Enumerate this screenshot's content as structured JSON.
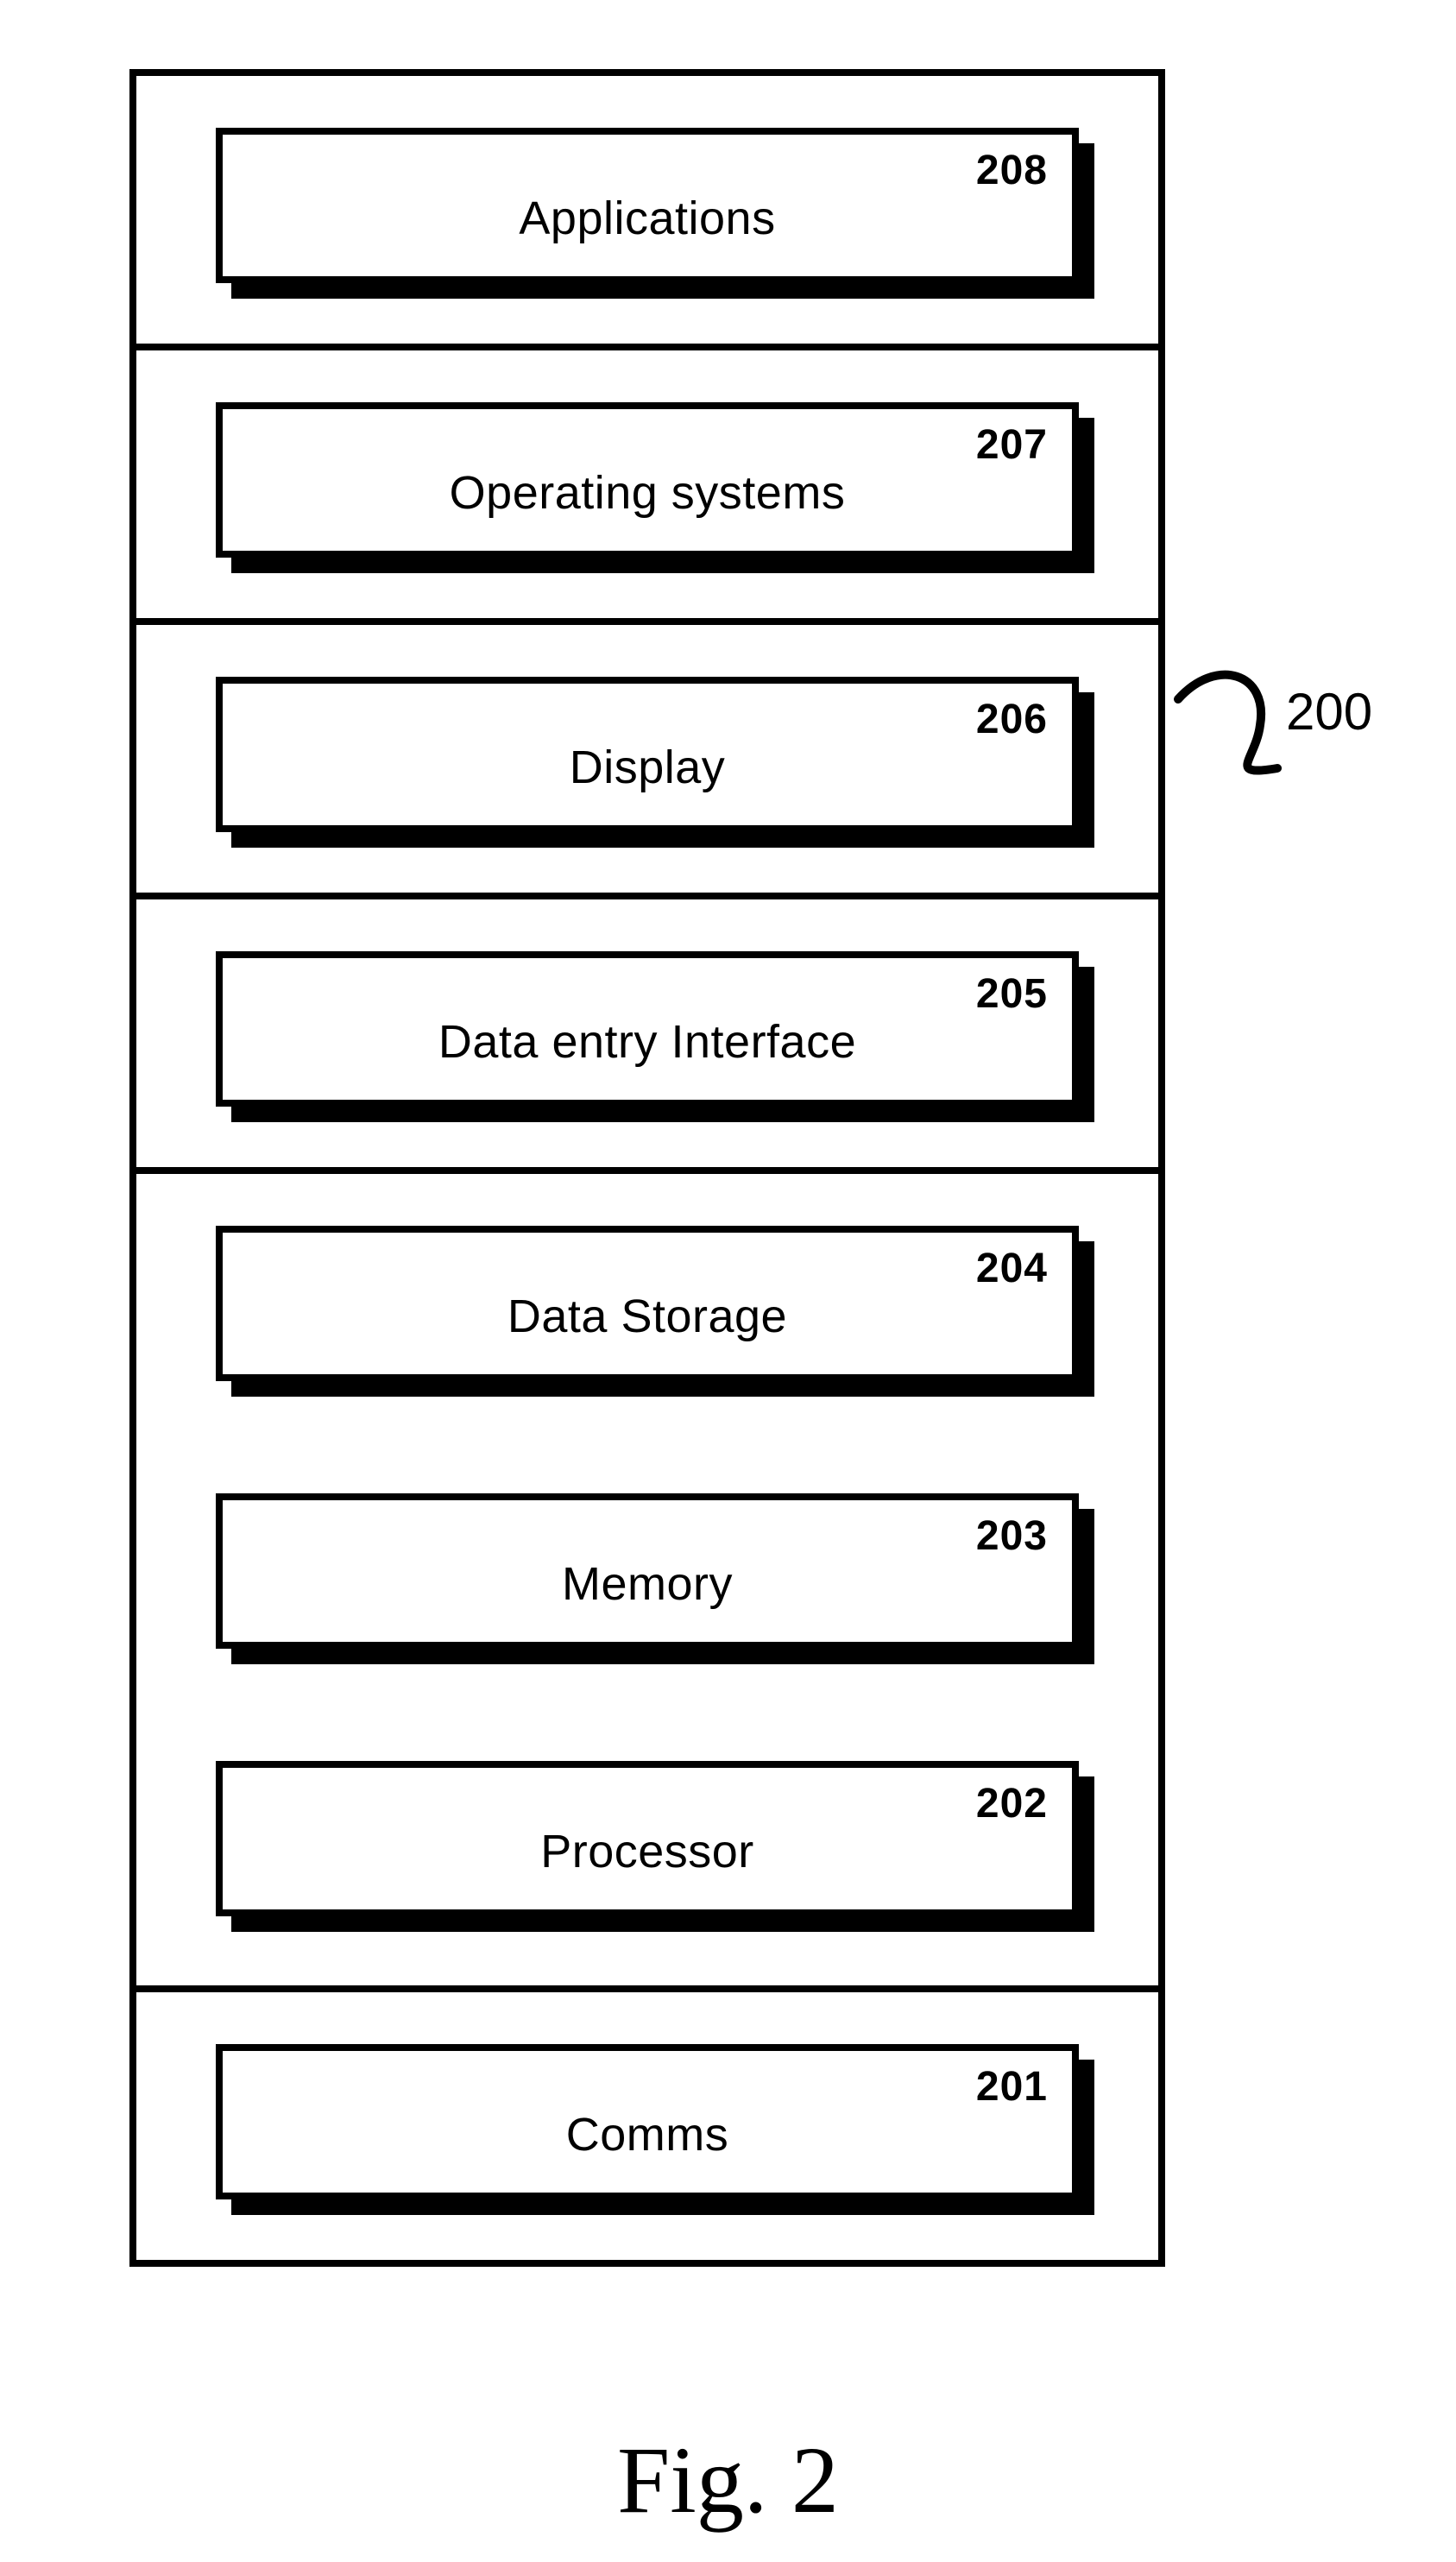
{
  "figure": {
    "caption": "Fig. 2",
    "pointer_ref": "200"
  },
  "sections": [
    {
      "blocks": [
        {
          "ref": "208",
          "label": "Applications"
        }
      ]
    },
    {
      "blocks": [
        {
          "ref": "207",
          "label": "Operating systems"
        }
      ]
    },
    {
      "blocks": [
        {
          "ref": "206",
          "label": "Display"
        }
      ]
    },
    {
      "blocks": [
        {
          "ref": "205",
          "label": "Data entry Interface"
        }
      ]
    },
    {
      "blocks": [
        {
          "ref": "204",
          "label": "Data Storage"
        },
        {
          "ref": "203",
          "label": "Memory"
        },
        {
          "ref": "202",
          "label": "Processor"
        }
      ]
    },
    {
      "blocks": [
        {
          "ref": "201",
          "label": "Comms"
        }
      ]
    }
  ]
}
